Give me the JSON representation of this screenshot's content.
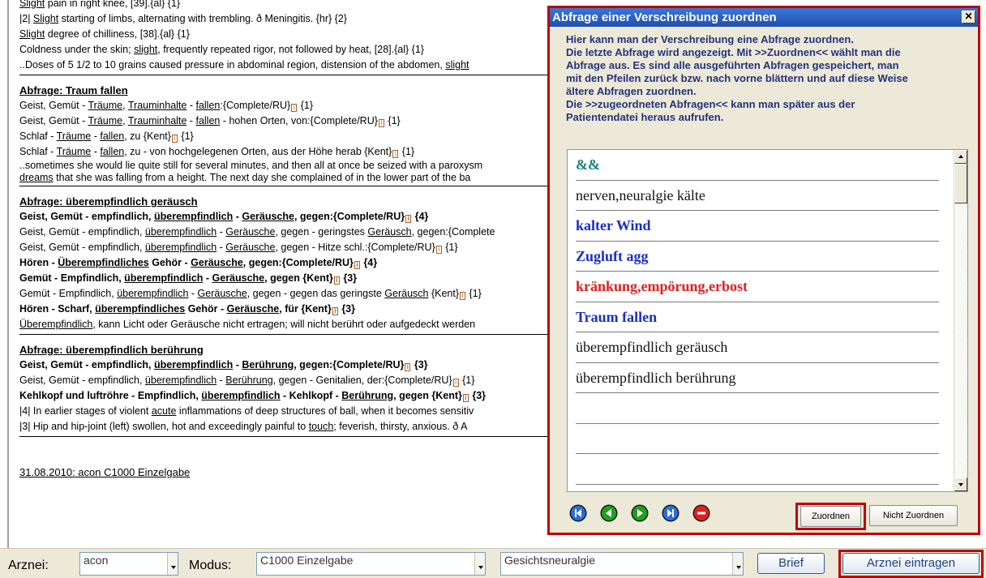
{
  "document": {
    "preamble": [
      {
        "parts": [
          {
            "t": "Slight",
            "u": true
          },
          {
            "t": " pain in right knee, [39].{al} {1}"
          }
        ]
      },
      {
        "parts": [
          {
            "t": "|2| "
          },
          {
            "t": "Slight",
            "u": true
          },
          {
            "t": " starting of limbs, alternating with trembling. ð Meningitis. {hr} {2}"
          }
        ]
      },
      {
        "parts": [
          {
            "t": "Slight",
            "u": true
          },
          {
            "t": " degree of chilliness, [38].{al} {1}"
          }
        ]
      },
      {
        "parts": [
          {
            "t": "Coldness under the skin; "
          },
          {
            "t": "slight",
            "u": true
          },
          {
            "t": ", frequently repeated rigor, not followed by heat, [28].{al} {1}"
          }
        ]
      },
      {
        "parts": [
          {
            "t": "..Doses of 5 1/2 to 10 grains caused pressure in abdominal region, distension of the abdomen, "
          },
          {
            "t": "slight",
            "u": true
          }
        ]
      }
    ],
    "sections": [
      {
        "heading": "Abfrage: Traum fallen",
        "lines": [
          {
            "style": "",
            "parts": [
              {
                "t": "Geist, Gemüt - "
              },
              {
                "t": "Träume",
                "u": true
              },
              {
                "t": ", "
              },
              {
                "t": "Trauminhalte",
                "u": true
              },
              {
                "t": " - "
              },
              {
                "t": "fallen",
                "u": true
              },
              {
                "t": ":{Complete/RU}"
              },
              {
                "icon": true
              },
              {
                "t": " {1}"
              }
            ]
          },
          {
            "style": "",
            "parts": [
              {
                "t": "Geist, Gemüt - "
              },
              {
                "t": "Träume",
                "u": true
              },
              {
                "t": ", "
              },
              {
                "t": "Trauminhalte",
                "u": true
              },
              {
                "t": " - "
              },
              {
                "t": "fallen",
                "u": true
              },
              {
                "t": " - hohen Orten, von:{Complete/RU}"
              },
              {
                "icon": true
              },
              {
                "t": " {1}"
              }
            ]
          },
          {
            "style": "",
            "parts": [
              {
                "t": "Schlaf - "
              },
              {
                "t": "Träume",
                "u": true
              },
              {
                "t": " - "
              },
              {
                "t": "fallen",
                "u": true
              },
              {
                "t": ", zu {Kent}"
              },
              {
                "icon": true
              },
              {
                "t": " {1}"
              }
            ]
          },
          {
            "style": "",
            "parts": [
              {
                "t": "Schlaf - "
              },
              {
                "t": "Träume",
                "u": true
              },
              {
                "t": " - "
              },
              {
                "t": "fallen",
                "u": true
              },
              {
                "t": ", zu - von hochgelegenen Orten, aus der Höhe herab {Kent}"
              },
              {
                "icon": true
              },
              {
                "t": " {1}"
              }
            ]
          },
          {
            "style": "lst",
            "parts": [
              {
                "t": "..sometimes she would lie quite still for several minutes, and then all at once be seized with a paroxysm"
              }
            ]
          },
          {
            "style": "lst",
            "parts": [
              {
                "t": "dreams",
                "u": true
              },
              {
                "t": " that she was falling from a height. The next day she complained of in the lower part of the ba"
              }
            ]
          }
        ]
      },
      {
        "heading": "Abfrage: überempfindlich geräusch",
        "lines": [
          {
            "style": "b",
            "parts": [
              {
                "t": "Geist, Gemüt - empfindlich, "
              },
              {
                "t": "überempfindlich",
                "u": true
              },
              {
                "t": " - "
              },
              {
                "t": "Geräusche",
                "u": true
              },
              {
                "t": ", gegen:{Complete/RU}"
              },
              {
                "icon": true
              },
              {
                "t": " {4}"
              }
            ]
          },
          {
            "style": "",
            "parts": [
              {
                "t": "Geist, Gemüt - empfindlich, "
              },
              {
                "t": "überempfindlich",
                "u": true
              },
              {
                "t": " - "
              },
              {
                "t": "Geräusche",
                "u": true
              },
              {
                "t": ", gegen - geringstes "
              },
              {
                "t": "Geräusch",
                "u": true
              },
              {
                "t": ", gegen:{Complete"
              }
            ]
          },
          {
            "style": "",
            "parts": [
              {
                "t": "Geist, Gemüt - empfindlich, "
              },
              {
                "t": "überempfindlich",
                "u": true
              },
              {
                "t": " - "
              },
              {
                "t": "Geräusche",
                "u": true
              },
              {
                "t": ", gegen - Hitze schl.:{Complete/RU}"
              },
              {
                "icon": true
              },
              {
                "t": " {1}"
              }
            ]
          },
          {
            "style": "b",
            "parts": [
              {
                "t": "Hören - "
              },
              {
                "t": "Überempfindliches",
                "u": true
              },
              {
                "t": " Gehör - "
              },
              {
                "t": "Geräusche",
                "u": true
              },
              {
                "t": ", gegen:{Complete/RU}"
              },
              {
                "icon": true
              },
              {
                "t": " {4}"
              }
            ]
          },
          {
            "style": "b",
            "parts": [
              {
                "t": "Gemüt - Empfindlich, "
              },
              {
                "t": "überempfindlich",
                "u": true
              },
              {
                "t": " - "
              },
              {
                "t": "Geräusche",
                "u": true
              },
              {
                "t": ", gegen {Kent}"
              },
              {
                "icon": true
              },
              {
                "t": " {3}"
              }
            ]
          },
          {
            "style": "",
            "parts": [
              {
                "t": "Gemüt - Empfindlich, "
              },
              {
                "t": "überempfindlich",
                "u": true
              },
              {
                "t": " - "
              },
              {
                "t": "Geräusche",
                "u": true
              },
              {
                "t": ", gegen - gegen das geringste "
              },
              {
                "t": "Geräusch",
                "u": true
              },
              {
                "t": " {Kent}"
              },
              {
                "icon": true
              },
              {
                "t": " {1}"
              }
            ]
          },
          {
            "style": "b",
            "parts": [
              {
                "t": "Hören - Scharf, "
              },
              {
                "t": "überempfindliches",
                "u": true
              },
              {
                "t": " Gehör - "
              },
              {
                "t": "Geräusche",
                "u": true
              },
              {
                "t": ", für {Kent}"
              },
              {
                "icon": true
              },
              {
                "t": " {3}"
              }
            ]
          },
          {
            "style": "",
            "parts": [
              {
                "t": "Überempfindlich",
                "u": true
              },
              {
                "t": ", kann Licht oder Geräusche nicht ertragen; will nicht berührt oder aufgedeckt werden"
              }
            ]
          }
        ]
      },
      {
        "heading": "Abfrage: überempfindlich berührung",
        "lines": [
          {
            "style": "b",
            "parts": [
              {
                "t": "Geist, Gemüt - empfindlich, "
              },
              {
                "t": "überempfindlich",
                "u": true
              },
              {
                "t": " - "
              },
              {
                "t": "Berührung",
                "u": true
              },
              {
                "t": ", gegen:{Complete/RU}"
              },
              {
                "icon": true
              },
              {
                "t": " {3}"
              }
            ]
          },
          {
            "style": "",
            "parts": [
              {
                "t": "Geist, Gemüt - empfindlich, "
              },
              {
                "t": "überempfindlich",
                "u": true
              },
              {
                "t": " - "
              },
              {
                "t": "Berührung",
                "u": true
              },
              {
                "t": ", gegen - Genitalien, der:{Complete/RU}"
              },
              {
                "icon": true
              },
              {
                "t": " {1}"
              }
            ]
          },
          {
            "style": "b",
            "parts": [
              {
                "t": "Kehlkopf und luftröhre - Empfindlich, "
              },
              {
                "t": "überempfindlich",
                "u": true
              },
              {
                "t": " - Kehlkopf - "
              },
              {
                "t": "Berührung",
                "u": true
              },
              {
                "t": ", gegen {Kent}"
              },
              {
                "icon": true
              },
              {
                "t": " {3}"
              }
            ]
          },
          {
            "style": "",
            "parts": [
              {
                "t": "|4| In earlier stages of violent "
              },
              {
                "t": "acute",
                "u": true
              },
              {
                "t": " inflammations of deep structures of ball, when it becomes sensitiv"
              }
            ]
          },
          {
            "style": "",
            "parts": [
              {
                "t": "|3| Hip and hip-joint (left) swollen, hot and exceedingly painful to "
              },
              {
                "t": "touch",
                "u": true
              },
              {
                "t": "; feverish, thirsty, anxious. ð A"
              }
            ]
          }
        ]
      }
    ],
    "footer_entry": "31.08.2010: acon C1000  Einzelgabe"
  },
  "dialog": {
    "title": "Abfrage einer Verschreibung zuordnen",
    "close_label": "✕",
    "description": [
      "Hier kann man der Verschreibung eine Abfrage zuordnen.",
      "Die letzte Abfrage wird angezeigt. Mit >>Zuordnen<< wählt man die",
      "Abfrage aus. Es sind alle ausgeführten Abfragen gespeichert, man",
      "mit den Pfeilen zurück bzw. nach vorne blättern und auf diese Weise",
      "ältere Abfragen zuordnen.",
      "Die >>zugeordneten Abfragen<< kann man später aus der",
      "Patientendatei heraus aufrufen."
    ],
    "list_items": [
      {
        "label": "&&",
        "style": "teal"
      },
      {
        "label": "nerven,neuralgie kälte",
        "style": "black"
      },
      {
        "label": "kalter Wind",
        "style": "blue"
      },
      {
        "label": "Zugluft agg",
        "style": "blue"
      },
      {
        "label": "kränkung,empörung,erbost",
        "style": "red"
      },
      {
        "label": "Traum fallen",
        "style": "blue"
      },
      {
        "label": "überempfindlich geräusch",
        "style": "black"
      },
      {
        "label": "überempfindlich berührung",
        "style": "black"
      },
      {
        "label": "",
        "style": "black"
      },
      {
        "label": "",
        "style": "black"
      },
      {
        "label": "",
        "style": "black"
      }
    ],
    "nav_buttons": [
      {
        "name": "first-record-icon",
        "color": "#2a6fdc"
      },
      {
        "name": "previous-record-icon",
        "color": "#1fa01f"
      },
      {
        "name": "next-record-icon",
        "color": "#1fa01f"
      },
      {
        "name": "last-record-icon",
        "color": "#2a6fdc"
      },
      {
        "name": "delete-record-icon",
        "color": "#e02020"
      }
    ],
    "assign_button": "Zuordnen",
    "not_assign_button": "Nicht Zuordnen"
  },
  "toolbar": {
    "arznei_label": "Arznei:",
    "arznei_value": "acon",
    "modus_label": "Modus:",
    "modus_value": "C1000  Einzelgabe",
    "complaint_value": "Gesichtsneuralgie",
    "brief_button": "Brief",
    "arznei_eintragen_button": "Arznei eintragen"
  }
}
